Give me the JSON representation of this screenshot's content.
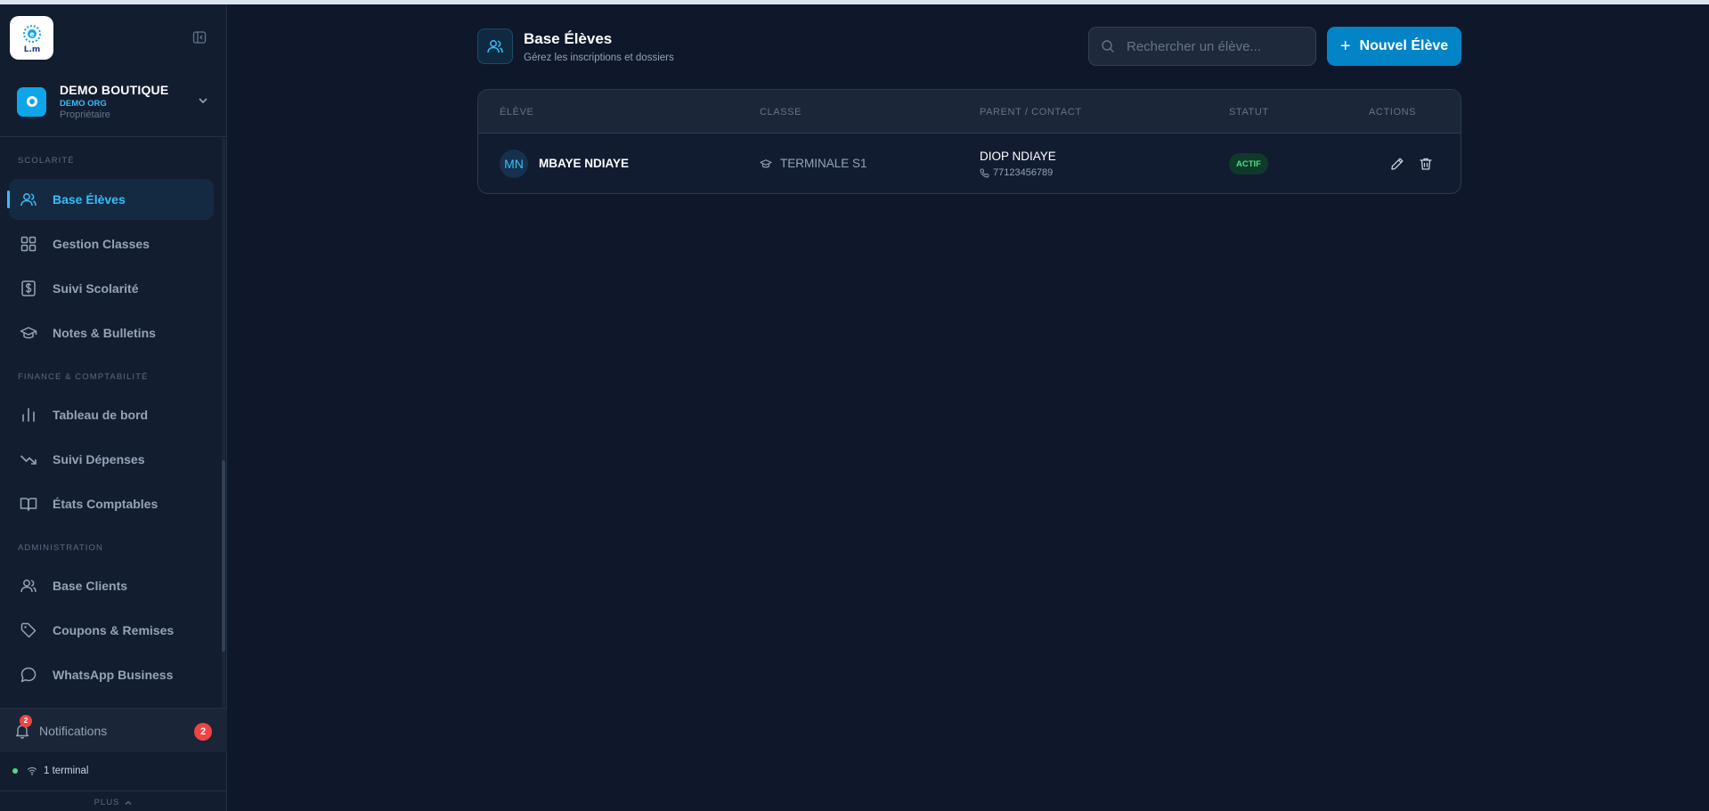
{
  "org": {
    "name": "DEMO BOUTIQUE",
    "sub": "DEMO ORG",
    "role": "Propriétaire"
  },
  "sidebar": {
    "sections": [
      {
        "title": "SCOLARITÉ",
        "items": [
          {
            "label": "Base Élèves",
            "icon": "users-icon",
            "active": true
          },
          {
            "label": "Gestion Classes",
            "icon": "grid-icon"
          },
          {
            "label": "Suivi Scolarité",
            "icon": "dollar-icon"
          },
          {
            "label": "Notes & Bulletins",
            "icon": "graduation-cap-icon"
          }
        ]
      },
      {
        "title": "FINANCE & COMPTABILITÉ",
        "items": [
          {
            "label": "Tableau de bord",
            "icon": "bar-chart-icon"
          },
          {
            "label": "Suivi Dépenses",
            "icon": "trending-down-icon"
          },
          {
            "label": "États Comptables",
            "icon": "book-icon"
          }
        ]
      },
      {
        "title": "ADMINISTRATION",
        "items": [
          {
            "label": "Base Clients",
            "icon": "users-icon"
          },
          {
            "label": "Coupons & Remises",
            "icon": "tag-icon"
          },
          {
            "label": "WhatsApp Business",
            "icon": "message-icon"
          }
        ]
      }
    ],
    "notifications": {
      "label": "Notifications",
      "count": "2",
      "bell_count": "2"
    },
    "terminal": {
      "label": "1 terminal"
    },
    "plus_label": "PLUS"
  },
  "page": {
    "title": "Base Élèves",
    "subtitle": "Gérez les inscriptions et dossiers"
  },
  "search": {
    "placeholder": "Rechercher un élève...",
    "value": ""
  },
  "new_button": {
    "label": "Nouvel Élève"
  },
  "table": {
    "headers": [
      "ÉLÈVE",
      "CLASSE",
      "PARENT / CONTACT",
      "STATUT",
      "ACTIONS"
    ],
    "rows": [
      {
        "initials": "MN",
        "name": "MBAYE NDIAYE",
        "class": "TERMINALE S1",
        "parent": "DIOP NDIAYE",
        "phone": "77123456789",
        "status": "ACTIF"
      }
    ]
  },
  "colors": {
    "background": "#0f172a",
    "sidebar": "#131d30",
    "accent": "#38bdf8",
    "primary_button": "#0284c7",
    "status_active": "#4ade80",
    "badge": "#ef4444"
  }
}
